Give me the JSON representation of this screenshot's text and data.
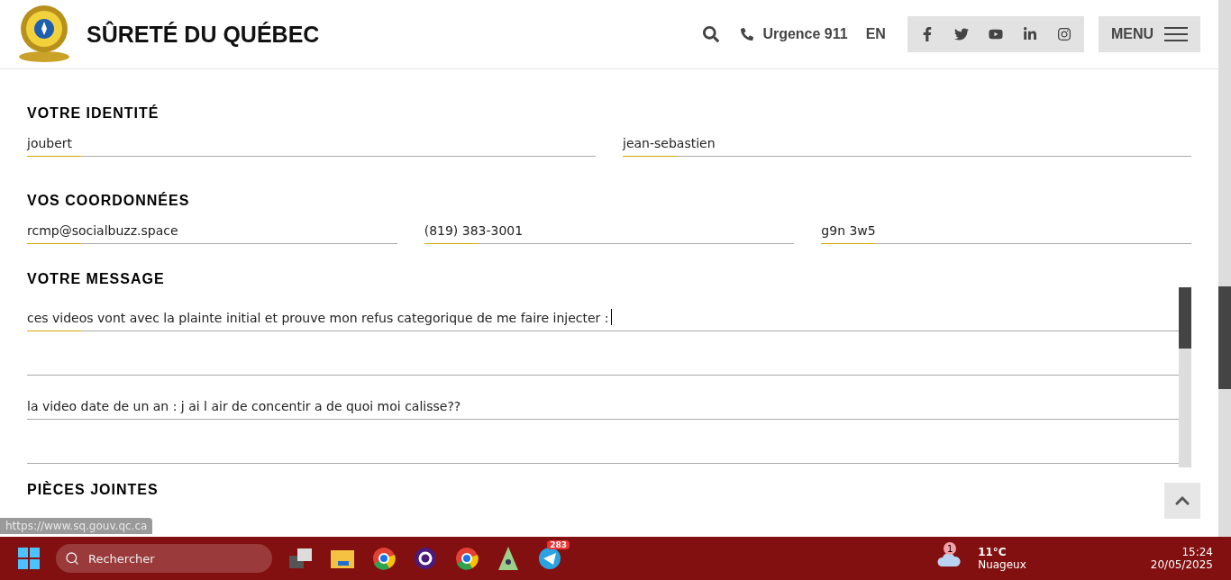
{
  "header": {
    "brand": "SÛRETÉ DU QUÉBEC",
    "emergency": "Urgence 911",
    "language": "EN",
    "menu": "MENU"
  },
  "sections": [
    {
      "title": "VOTRE IDENTITÉ",
      "fields": [
        {
          "value": "joubert"
        },
        {
          "value": "jean-sebastien"
        }
      ]
    },
    {
      "title": "VOS COORDONNÉES",
      "fields": [
        {
          "value": "rcmp@socialbuzz.space"
        },
        {
          "value": "(819) 383-3001"
        },
        {
          "value": "g9n 3w5"
        }
      ]
    }
  ],
  "message": {
    "title": "VOTRE MESSAGE",
    "paragraphs": [
      "ces videos vont avec la plainte initial et prouve mon refus categorique de me faire injecter :",
      "la video date de un an : j ai l air de concentir a de quoi moi calisse??"
    ]
  },
  "next_section": "PIÈCES JOINTES",
  "status_link": "https://www.sq.gouv.qc.ca",
  "taskbar": {
    "search_placeholder": "Rechercher",
    "telegram_badge": "283",
    "weather_badge": "1",
    "temperature": "11°C",
    "weather": "Nuageux",
    "time": "15:24",
    "date": "20/05/2025"
  }
}
